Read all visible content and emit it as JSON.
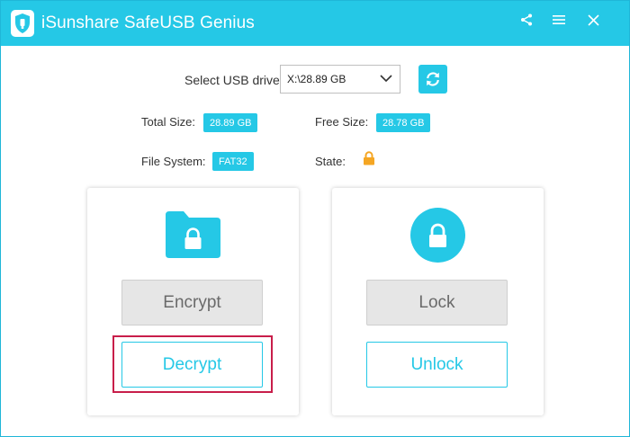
{
  "app": {
    "title": "iSunshare SafeUSB Genius"
  },
  "titlebar": {
    "icons": [
      "share-icon",
      "menu-icon",
      "close-icon"
    ]
  },
  "drive": {
    "label": "Select USB drive:",
    "selected": "X:\\28.89 GB"
  },
  "info": {
    "total_size_label": "Total Size:",
    "total_size": "28.89 GB",
    "free_size_label": "Free Size:",
    "free_size": "28.78 GB",
    "file_system_label": "File System:",
    "file_system": "FAT32",
    "state_label": "State:",
    "state_icon": "lock-icon"
  },
  "encrypt_card": {
    "icon": "folder-lock-icon",
    "encrypt_label": "Encrypt",
    "decrypt_label": "Decrypt"
  },
  "lock_card": {
    "icon": "circle-lock-icon",
    "lock_label": "Lock",
    "unlock_label": "Unlock"
  },
  "colors": {
    "accent": "#25c8e6",
    "state_lock": "#f5a623",
    "highlight": "#c81e4a",
    "disabled_bg": "#e6e6e6"
  }
}
